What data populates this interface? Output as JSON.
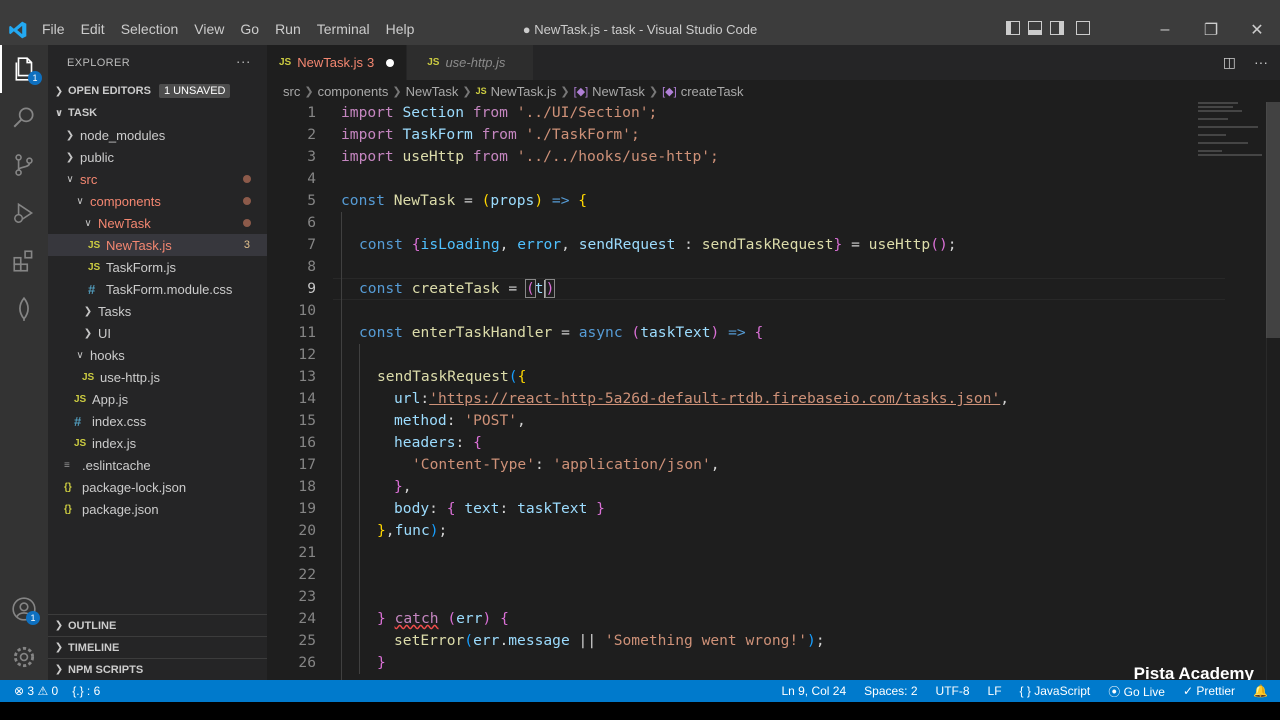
{
  "window": {
    "title": "● NewTask.js - task - Visual Studio Code",
    "menu": [
      "File",
      "Edit",
      "Selection",
      "View",
      "Go",
      "Run",
      "Terminal",
      "Help"
    ],
    "controls": [
      "–",
      "❐",
      "✕"
    ]
  },
  "activity_bar": {
    "explorer_badge": "1",
    "accounts_badge": "1",
    "items": [
      "explorer-icon",
      "search-icon",
      "source-control-icon",
      "run-debug-icon",
      "extensions-icon",
      "mongodb-leaf-icon",
      "accounts-icon",
      "gear-icon"
    ]
  },
  "sidebar": {
    "header": "EXPLORER",
    "more": "···",
    "open_editors": {
      "label": "OPEN EDITORS",
      "badge": "1 UNSAVED"
    },
    "project": "TASK",
    "tree": [
      {
        "label": "node_modules",
        "type": "folder",
        "open": false
      },
      {
        "label": "public",
        "type": "folder",
        "open": false
      },
      {
        "label": "src",
        "type": "folder",
        "open": true
      },
      {
        "label": "components",
        "type": "folder",
        "open": true
      },
      {
        "label": "NewTask",
        "type": "folder",
        "open": true
      },
      {
        "label": "NewTask.js",
        "type": "js",
        "problems": "3"
      },
      {
        "label": "TaskForm.js",
        "type": "js"
      },
      {
        "label": "TaskForm.module.css",
        "type": "css"
      },
      {
        "label": "Tasks",
        "type": "folder",
        "open": false
      },
      {
        "label": "UI",
        "type": "folder",
        "open": false
      },
      {
        "label": "hooks",
        "type": "folder",
        "open": true
      },
      {
        "label": "use-http.js",
        "type": "js"
      },
      {
        "label": "App.js",
        "type": "js"
      },
      {
        "label": "index.css",
        "type": "css"
      },
      {
        "label": "index.js",
        "type": "js"
      },
      {
        "label": ".eslintcache",
        "type": "file"
      },
      {
        "label": "package-lock.json",
        "type": "json"
      },
      {
        "label": "package.json",
        "type": "json"
      }
    ],
    "outline": "OUTLINE",
    "timeline": "TIMELINE",
    "npm_scripts": "NPM SCRIPTS"
  },
  "tabs": [
    {
      "label": "NewTask.js",
      "problems": "3",
      "active": true,
      "dirty": true
    },
    {
      "label": "use-http.js",
      "active": false
    }
  ],
  "file_icon_label": "JS",
  "breadcrumb": [
    "src",
    "components",
    "NewTask",
    "NewTask.js",
    "NewTask",
    "createTask"
  ],
  "code_lines": [
    "1",
    "2",
    "3",
    "4",
    "5",
    "6",
    "7",
    "8",
    "9",
    "10",
    "11",
    "12",
    "13",
    "14",
    "15",
    "16",
    "17",
    "18",
    "19",
    "20",
    "21",
    "22",
    "23",
    "24",
    "25",
    "26"
  ],
  "code": {
    "l1": [
      "import",
      " Section ",
      "from",
      " '../UI/Section';"
    ],
    "l2": [
      "import",
      " TaskForm ",
      "from",
      " './TaskForm';"
    ],
    "l3": [
      "import",
      " useHttp ",
      "from",
      " '../../hooks/use-http';"
    ],
    "l5": [
      "const",
      " NewTask",
      " = ",
      "(",
      "props",
      ")",
      " => ",
      "{"
    ],
    "l7": [
      "const",
      " ",
      "{",
      "isLoading",
      ", ",
      "error",
      ", ",
      "sendRequest",
      " : ",
      "sendTaskRequest",
      "}",
      " = ",
      "useHttp",
      "()",
      ";"
    ],
    "l9": [
      "const",
      " ",
      "createTask",
      " = ",
      "(",
      "t",
      ")"
    ],
    "l11": [
      "const",
      " ",
      "enterTaskHandler",
      " = ",
      "async",
      " ",
      "(",
      "taskText",
      ")",
      " => ",
      "{"
    ],
    "l13": [
      "sendTaskRequest",
      "(",
      "{"
    ],
    "l14": [
      "url",
      ":",
      "'https://react-http-5a26d-default-rtdb.firebaseio.com/tasks.json'",
      ","
    ],
    "l15": [
      "method",
      ": ",
      "'POST'",
      ","
    ],
    "l16": [
      "headers",
      ": ",
      "{"
    ],
    "l17": [
      "'Content-Type'",
      ": ",
      "'application/json'",
      ","
    ],
    "l18": [
      "}",
      ","
    ],
    "l19": [
      "body",
      ": ",
      "{",
      " ",
      "text",
      ": ",
      "taskText",
      " ",
      "}"
    ],
    "l20": [
      "}",
      ",",
      "func",
      ")",
      ";"
    ],
    "l24": [
      "}",
      " ",
      "catch",
      " ",
      "(",
      "err",
      ")",
      " ",
      "{"
    ],
    "l25": [
      "setError",
      "(",
      "err",
      ".",
      "message",
      " || ",
      "'Something went wrong!'",
      ")",
      ";"
    ],
    "l26": [
      "}"
    ]
  },
  "watermark": "Pista Academy",
  "status": {
    "errors": "3",
    "warnings": "0",
    "braces": "{.} : 6",
    "position": "Ln 9, Col 24",
    "spaces": "Spaces: 2",
    "encoding": "UTF-8",
    "eol": "LF",
    "language": "JavaScript",
    "golive": "Go Live",
    "prettier": "Prettier"
  },
  "colors": {
    "statusbar": "#007acc",
    "keyword": "#569cd6",
    "string": "#ce9178",
    "function": "#dcdcaa",
    "variable": "#9cdcfe"
  }
}
